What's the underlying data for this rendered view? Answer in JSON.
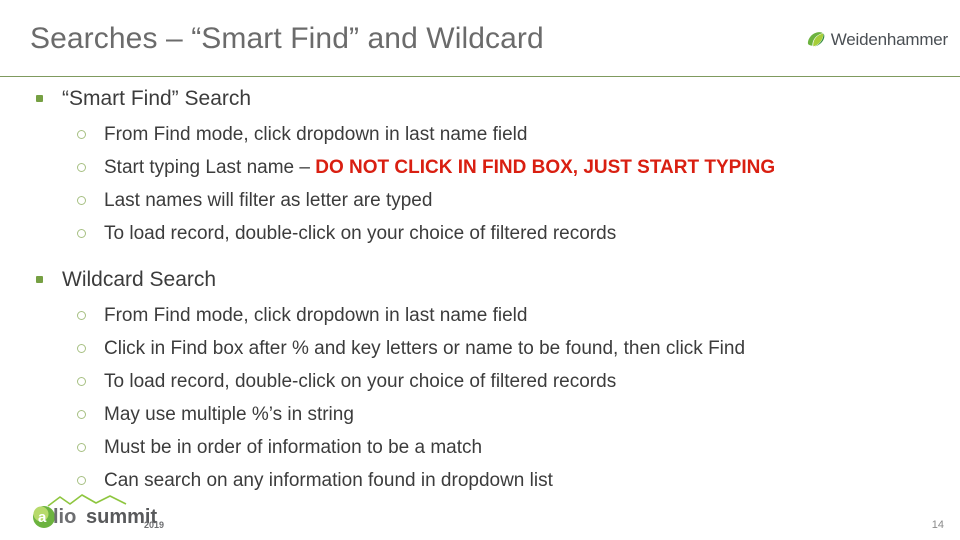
{
  "header": {
    "title": "Searches – “Smart Find” and Wildcard",
    "brand": {
      "name": "Weidenhammer",
      "mark_color": "#7ab648"
    },
    "divider_color": "#7f9a5e"
  },
  "colors": {
    "title_gray": "#6b6b6b",
    "body_text": "#3c3c3c",
    "bullet_green": "#76a043",
    "sub_bullet_green": "#a7c083",
    "alert_red": "#d91f11"
  },
  "content": {
    "sections": [
      {
        "heading": "“Smart Find” Search",
        "items": [
          {
            "text": "From Find mode, click dropdown in last name field"
          },
          {
            "text": "Start typing Last name – ",
            "emphasis": "DO NOT CLICK IN FIND BOX, JUST START TYPING"
          },
          {
            "text": "Last names will filter as letter are typed"
          },
          {
            "text": "To load record, double-click on your choice of filtered records"
          }
        ]
      },
      {
        "heading": "Wildcard Search",
        "items": [
          {
            "text": "From Find mode, click dropdown in last name field"
          },
          {
            "text": "Click in Find box after % and key letters or name to be found, then click Find"
          },
          {
            "text": "To load record, double-click on your choice of filtered records"
          },
          {
            "text": "May use multiple %’s in string"
          },
          {
            "text": "Must be in order of information to be a match"
          },
          {
            "text": "Can search on any information found in dropdown list"
          }
        ]
      }
    ]
  },
  "footer": {
    "logo_text": "alio summit",
    "logo_year": "2019",
    "page_number": "14"
  }
}
